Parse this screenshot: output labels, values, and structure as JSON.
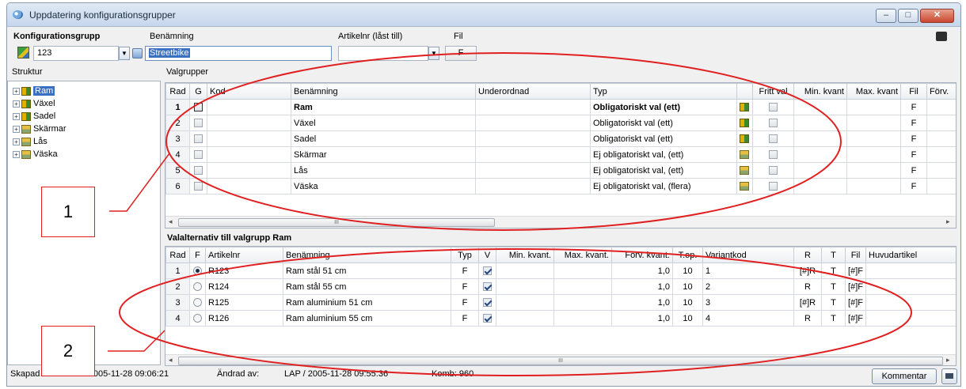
{
  "window": {
    "title": "Uppdatering konfigurationsgrupper",
    "minimize_label": "–",
    "maximize_label": "□",
    "close_label": "✕"
  },
  "header": {
    "group_label": "Konfigurationsgrupp",
    "group_value": "123",
    "name_label": "Benämning",
    "name_value": "Streetbike",
    "article_label": "Artikelnr (låst till)",
    "article_value": "",
    "file_label": "Fil",
    "file_value": "F"
  },
  "tree": {
    "label": "Struktur",
    "items": [
      {
        "label": "Ram",
        "icon": "obligatory-icon",
        "selected": true
      },
      {
        "label": "Växel",
        "icon": "obligatory-icon",
        "selected": false
      },
      {
        "label": "Sadel",
        "icon": "obligatory-icon",
        "selected": false
      },
      {
        "label": "Skärmar",
        "icon": "optional-single-icon",
        "selected": false
      },
      {
        "label": "Lås",
        "icon": "optional-single-icon",
        "selected": false
      },
      {
        "label": "Väska",
        "icon": "optional-multi-icon",
        "selected": false
      }
    ]
  },
  "valgrupper": {
    "label": "Valgrupper",
    "columns": [
      "Rad",
      "G",
      "Kod",
      "Benämning",
      "Underordnad",
      "Typ",
      "",
      "Fritt val",
      "Min. kvant",
      "Max. kvant",
      "Fil",
      "Förv."
    ],
    "rows": [
      {
        "rad": "1",
        "kod": "",
        "name": "Ram",
        "under": "",
        "typ": "Obligatoriskt val (ett)",
        "fil": "F",
        "bold": true
      },
      {
        "rad": "2",
        "kod": "",
        "name": "Växel",
        "under": "",
        "typ": "Obligatoriskt val (ett)",
        "fil": "F",
        "bold": false
      },
      {
        "rad": "3",
        "kod": "",
        "name": "Sadel",
        "under": "",
        "typ": "Obligatoriskt val (ett)",
        "fil": "F",
        "bold": false
      },
      {
        "rad": "4",
        "kod": "",
        "name": "Skärmar",
        "under": "",
        "typ": "Ej obligatoriskt val, (ett)",
        "fil": "F",
        "bold": false
      },
      {
        "rad": "5",
        "kod": "",
        "name": "Lås",
        "under": "",
        "typ": "Ej obligatoriskt val, (ett)",
        "fil": "F",
        "bold": false
      },
      {
        "rad": "6",
        "kod": "",
        "name": "Väska",
        "under": "",
        "typ": "Ej obligatoriskt val, (flera)",
        "fil": "F",
        "bold": false
      }
    ]
  },
  "valalternativ": {
    "label": "Valalternativ till valgrupp Ram",
    "columns": [
      "Rad",
      "F",
      "Artikelnr",
      "Benämning",
      "Typ",
      "V",
      "Min. kvant.",
      "Max. kvant.",
      "Förv. kvant.",
      "T.op.",
      "Variantkod",
      "R",
      "T",
      "Fil",
      "Huvudartikel"
    ],
    "rows": [
      {
        "rad": "1",
        "f": true,
        "art": "R123",
        "name": "Ram stål 51 cm",
        "typ": "F",
        "min": "",
        "max": "",
        "forv": "1,0",
        "top": "10",
        "var": "1",
        "r": "[#]R",
        "t": "T",
        "fil": "[#]F",
        "huvud": ""
      },
      {
        "rad": "2",
        "f": false,
        "art": "R124",
        "name": "Ram stål 55 cm",
        "typ": "F",
        "min": "",
        "max": "",
        "forv": "1,0",
        "top": "10",
        "var": "2",
        "r": "R",
        "t": "T",
        "fil": "[#]F",
        "huvud": ""
      },
      {
        "rad": "3",
        "f": false,
        "art": "R125",
        "name": "Ram aluminium 51 cm",
        "typ": "F",
        "min": "",
        "max": "",
        "forv": "1,0",
        "top": "10",
        "var": "3",
        "r": "[#]R",
        "t": "T",
        "fil": "[#]F",
        "huvud": ""
      },
      {
        "rad": "4",
        "f": false,
        "art": "R126",
        "name": "Ram aluminium 55 cm",
        "typ": "F",
        "min": "",
        "max": "",
        "forv": "1,0",
        "top": "10",
        "var": "4",
        "r": "R",
        "t": "T",
        "fil": "[#]F",
        "huvud": ""
      }
    ]
  },
  "status": {
    "created_label": "Skapad av:",
    "created_value": "LAP / 2005-11-28 09:06:21",
    "changed_label": "Ändrad av:",
    "changed_value": "LAP / 2005-11-28 09:55:36",
    "komb": "Komb: 960",
    "comment_button": "Kommentar"
  },
  "annotations": {
    "callout1": "1",
    "callout2": "2",
    "color": "#e02020"
  },
  "scroll": {
    "arrow_left": "◂",
    "arrow_right": "▸",
    "thumb": "III"
  }
}
